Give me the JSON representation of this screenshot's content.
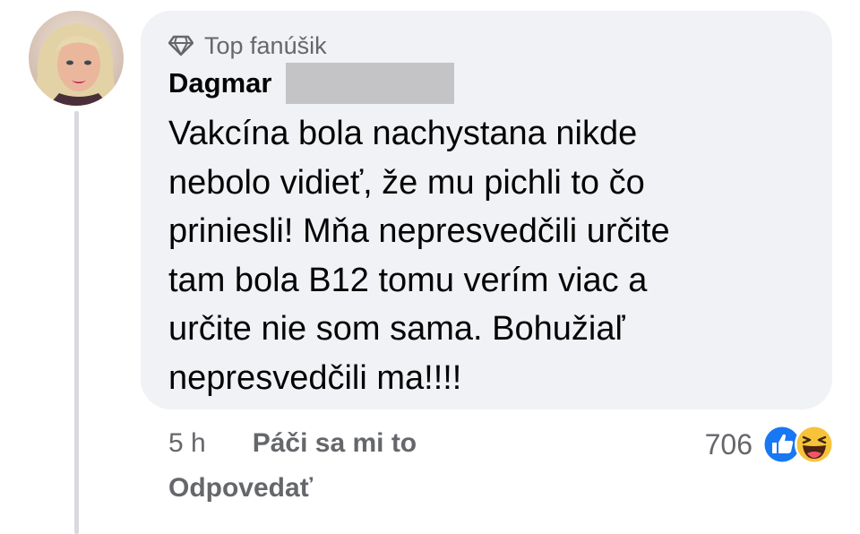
{
  "comment": {
    "badge_icon": "diamond-icon",
    "badge_label": "Top fanúšik",
    "author_name": "Dagmar",
    "text": "Vakcína bola nachystana nikde\nnebolo vidieť, že mu pichli to čo\npriniesli! Mňa nepresvedčili určite\ntam bola B12 tomu verím viac a\nurčite nie som sama. Bohužiaľ\nnepresvedčili ma!!!!",
    "time": "5 h",
    "like_label": "Páči sa mi to",
    "reply_label": "Odpovedať",
    "reaction_count": "706",
    "reactions": [
      "like-reaction-icon",
      "haha-reaction-icon"
    ]
  },
  "colors": {
    "bubble": "#f0f2f5",
    "text": "#050505",
    "secondary_text": "#65676b",
    "like_blue": "#1877f2",
    "haha_yellow": "#f7c33b",
    "thread_line": "#d9dade"
  }
}
